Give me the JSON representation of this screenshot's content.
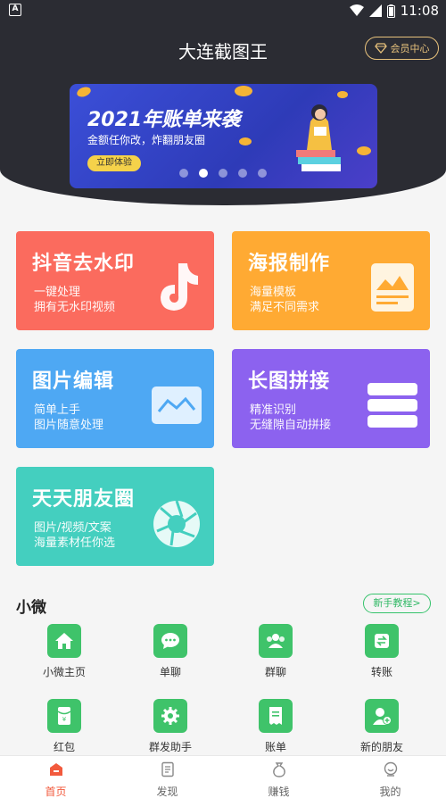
{
  "status": {
    "left_glyph": "A",
    "time": "11:08"
  },
  "header": {
    "title": "大连截图王",
    "vip_label": "会员中心"
  },
  "banner": {
    "title": "2021年账单来袭",
    "subtitle": "金额任你改，炸翻朋友圈",
    "button": "立即体验",
    "slide_count": 5,
    "active_slide": 2
  },
  "cards": [
    {
      "title": "抖音去水印",
      "line1": "一键处理",
      "line2": "拥有无水印视频",
      "icon": "tiktok-icon"
    },
    {
      "title": "海报制作",
      "line1": "海量模板",
      "line2": "满足不同需求",
      "icon": "poster-icon"
    },
    {
      "title": "图片编辑",
      "line1": "简单上手",
      "line2": "图片随意处理",
      "icon": "image-edit-icon"
    },
    {
      "title": "长图拼接",
      "line1": "精准识别",
      "line2": "无缝隙自动拼接",
      "icon": "stack-icon"
    },
    {
      "title": "天天朋友圈",
      "line1": "图片/视频/文案",
      "line2": "海量素材任你选",
      "icon": "aperture-icon"
    }
  ],
  "section": {
    "title": "小微",
    "tutorial": "新手教程>"
  },
  "grid": [
    {
      "label": "小微主页",
      "icon": "home-icon"
    },
    {
      "label": "单聊",
      "icon": "chat-icon"
    },
    {
      "label": "群聊",
      "icon": "group-icon"
    },
    {
      "label": "转账",
      "icon": "transfer-icon"
    },
    {
      "label": "红包",
      "icon": "red-packet-icon"
    },
    {
      "label": "群发助手",
      "icon": "gear-icon"
    },
    {
      "label": "账单",
      "icon": "bill-icon"
    },
    {
      "label": "新的朋友",
      "icon": "add-friend-icon"
    }
  ],
  "tabs": [
    {
      "label": "首页",
      "icon": "home-tab-icon",
      "active": true
    },
    {
      "label": "发现",
      "icon": "discover-tab-icon",
      "active": false
    },
    {
      "label": "赚钱",
      "icon": "money-bag-icon",
      "active": false
    },
    {
      "label": "我的",
      "icon": "profile-tab-icon",
      "active": false
    }
  ],
  "colors": {
    "header_bg": "#2b2c33",
    "accent": "#f25a3d",
    "green": "#3fc36a",
    "gold": "#e8c27c"
  }
}
